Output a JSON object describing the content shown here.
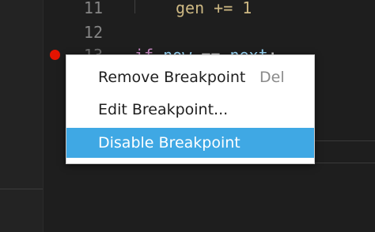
{
  "editor": {
    "lines": [
      {
        "number": "11",
        "text": "gen += 1"
      },
      {
        "number": "12",
        "text": ""
      },
      {
        "number": "13",
        "tokens": [
          "if",
          "now",
          "==",
          "next",
          ":"
        ]
      }
    ],
    "colors": {
      "background": "#1e1e1e",
      "breakpoint": "#e51400"
    }
  },
  "context_menu": {
    "items": [
      {
        "label": "Remove Breakpoint",
        "shortcut": "Del"
      },
      {
        "label": "Edit Breakpoint..."
      },
      {
        "label": "Disable Breakpoint",
        "selected": true
      }
    ],
    "highlight_color": "#3fa8e4"
  }
}
